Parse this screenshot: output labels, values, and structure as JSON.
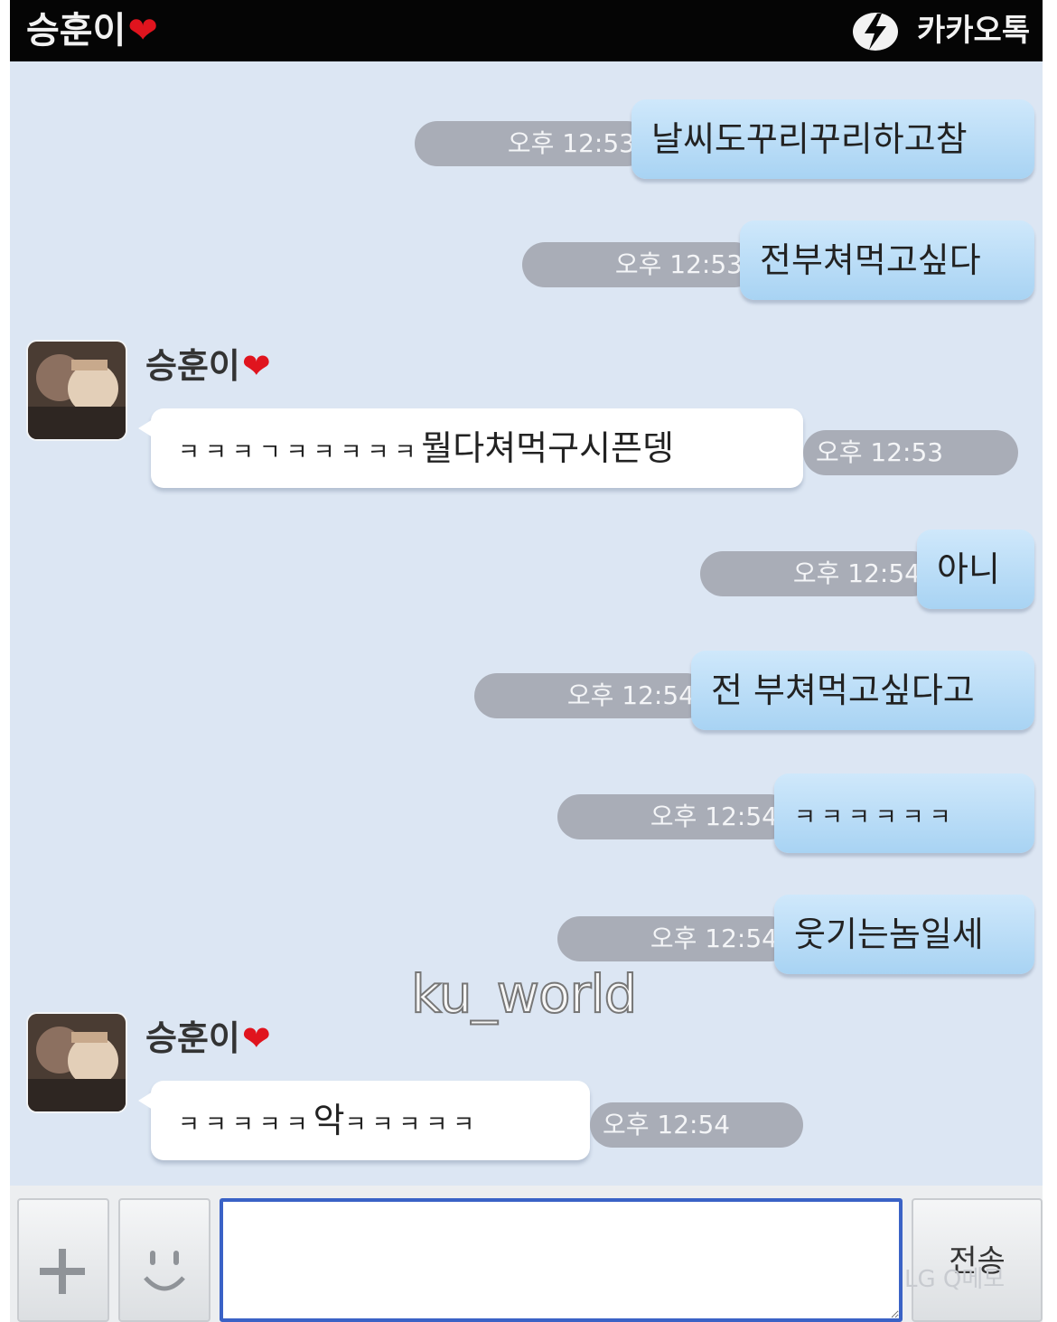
{
  "title_bar": {
    "chat_name": "승훈이",
    "app_name": "카카오톡"
  },
  "messages": [
    {
      "side": "out",
      "text": "날씨도꾸리꾸리하고참",
      "time": "오후 12:53"
    },
    {
      "side": "out",
      "text": "전부쳐먹고싶다",
      "time": "오후 12:53"
    },
    {
      "side": "in",
      "sender": "승훈이",
      "text_small": "ㅋㅋㅋㄱㅋㅋㅋㅋㅋ",
      "text": "뭘다쳐먹구시픈뎅",
      "time": "오후 12:53"
    },
    {
      "side": "out",
      "text": "아니",
      "time": "오후 12:54"
    },
    {
      "side": "out",
      "text": "전 부쳐먹고싶다고",
      "time": "오후 12:54"
    },
    {
      "side": "out",
      "text": "ㅋㅋㅋㅋㅋㅋ",
      "time": "오후 12:54"
    },
    {
      "side": "out",
      "text": "웃기는놈일세",
      "time": "오후 12:54"
    },
    {
      "side": "in",
      "sender": "승훈이",
      "text_small": "ㅋㅋㅋㅋㅋ",
      "text": "악",
      "text_small_after": "ㅋㅋㅋㅋㅋ",
      "time": "오후 12:54"
    }
  ],
  "watermark": "ku_world",
  "input_bar": {
    "send_label": "전송",
    "input_value": "",
    "brand": "LG Q메모"
  },
  "colors": {
    "background": "#dce6f3",
    "out_bubble": "#b8dcf6",
    "in_bubble": "#ffffff",
    "time_pill": "#a9adb7",
    "input_border": "#3a62c6"
  }
}
